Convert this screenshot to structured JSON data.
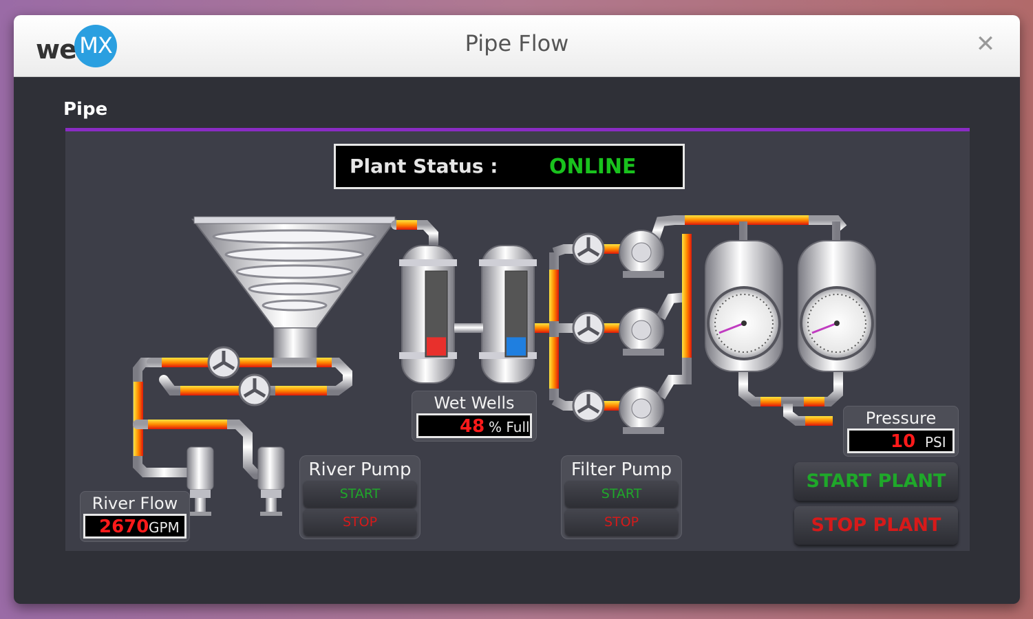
{
  "window": {
    "title": "Pipe Flow",
    "logo": {
      "we": "we",
      "mx": "MX"
    },
    "close_glyph": "✕"
  },
  "tab": {
    "label": "Pipe"
  },
  "plant_status": {
    "label": "Plant Status :",
    "value": "ONLINE"
  },
  "wet_wells": {
    "label": "Wet Wells",
    "value": "48",
    "unit": "% Full",
    "tank_left_level": 0.22,
    "tank_right_level": 0.22,
    "tank_left_color": "#e8302c",
    "tank_right_color": "#1f7fe0"
  },
  "river_flow": {
    "label": "River Flow",
    "value": "2670",
    "unit": "GPM"
  },
  "pressure": {
    "label": "Pressure",
    "value": "10",
    "unit": "PSI"
  },
  "river_pump": {
    "label": "River Pump",
    "start": "START",
    "stop": "STOP"
  },
  "filter_pump": {
    "label": "Filter Pump",
    "start": "START",
    "stop": "STOP"
  },
  "plant_controls": {
    "start": "START PLANT",
    "stop": "STOP PLANT"
  },
  "colors": {
    "accent": "#8a2cc4",
    "status_online": "#19c21d",
    "readout_value": "#ff1a1a",
    "start_green": "#1fa82a",
    "stop_red": "#d61a1a"
  }
}
